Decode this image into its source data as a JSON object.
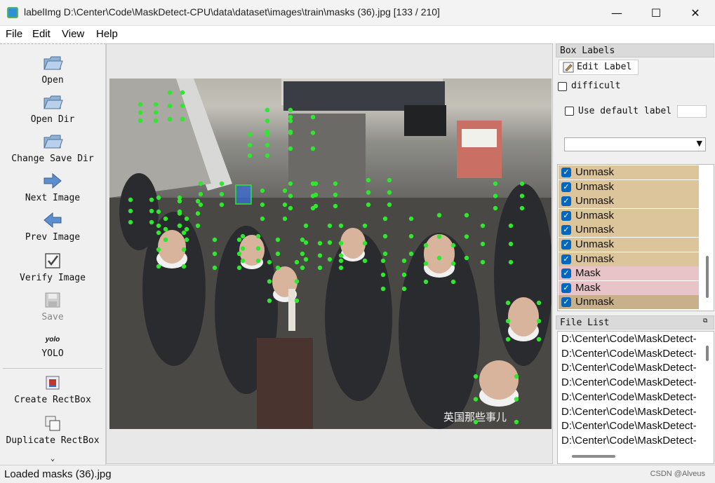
{
  "window": {
    "title": "labelImg D:\\Center\\Code\\MaskDetect-CPU\\data\\dataset\\images\\train\\masks (36).jpg [133 / 210]",
    "minimize": "—",
    "maximize": "☐",
    "close": "✕"
  },
  "menu": {
    "file": "File",
    "edit": "Edit",
    "view": "View",
    "help": "Help"
  },
  "toolbar": {
    "open": "Open",
    "open_dir": "Open Dir",
    "change_save_dir": "Change Save Dir",
    "next_image": "Next Image",
    "prev_image": "Prev Image",
    "verify_image": "Verify Image",
    "save": "Save",
    "yolo_icon_text": "yolo",
    "yolo": "YOLO",
    "create_rectbox": "Create RectBox",
    "duplicate_rectbox": "Duplicate RectBox",
    "more": "⌄"
  },
  "watermark": "英国那些事儿",
  "box_labels": {
    "title": "Box Labels",
    "edit_label": "Edit Label",
    "difficult": "difficult",
    "use_default_label": "Use default label",
    "labels": [
      "Unmask",
      "Unmask",
      "Unmask",
      "Unmask",
      "Unmask",
      "Unmask",
      "Unmask",
      "Mask",
      "Mask",
      "Unmask"
    ],
    "label_colors": [
      "#dcc49b",
      "#dcc49b",
      "#dcc49b",
      "#dcc49b",
      "#dcc49b",
      "#dcc49b",
      "#dcc49b",
      "#e8c4c8",
      "#e8c4c8",
      "#c8b08a"
    ]
  },
  "file_list": {
    "title": "File List",
    "items": [
      "D:\\Center\\Code\\MaskDetect-",
      "D:\\Center\\Code\\MaskDetect-",
      "D:\\Center\\Code\\MaskDetect-",
      "D:\\Center\\Code\\MaskDetect-",
      "D:\\Center\\Code\\MaskDetect-",
      "D:\\Center\\Code\\MaskDetect-",
      "D:\\Center\\Code\\MaskDetect-",
      "D:\\Center\\Code\\MaskDetect-"
    ]
  },
  "status": {
    "text": "Loaded masks (36).jpg",
    "credit": "CSDN @Alveus"
  },
  "colors": {
    "vertex": "#2ee82e",
    "selected_box": "#3a6fd8"
  }
}
